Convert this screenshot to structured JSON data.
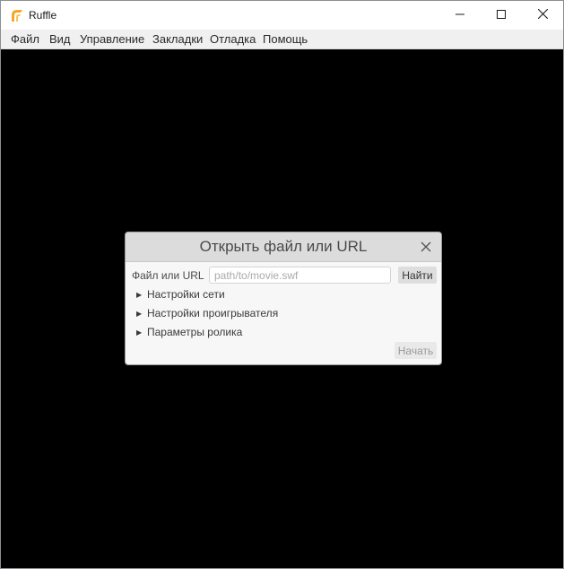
{
  "app": {
    "title": "Ruffle",
    "icon": "ruffle-logo-icon",
    "accent": "#f6a623"
  },
  "window_controls": {
    "minimize": "minimize-icon",
    "maximize": "maximize-icon",
    "close": "close-icon"
  },
  "menu": {
    "items": [
      {
        "label": "Файл"
      },
      {
        "label": "Вид"
      },
      {
        "label": "Управление"
      },
      {
        "label": "Закладки"
      },
      {
        "label": "Отладка"
      },
      {
        "label": "Помощь"
      }
    ]
  },
  "dialog": {
    "title": "Открыть файл или URL",
    "field_label": "Файл или URL",
    "url_placeholder": "path/to/movie.swf",
    "url_value": "",
    "find_label": "Найти",
    "sections": [
      {
        "label": "Настройки сети",
        "expanded": false
      },
      {
        "label": "Настройки проигрывателя",
        "expanded": false
      },
      {
        "label": "Параметры ролика",
        "expanded": false
      }
    ],
    "start_label": "Начать",
    "start_enabled": false
  }
}
